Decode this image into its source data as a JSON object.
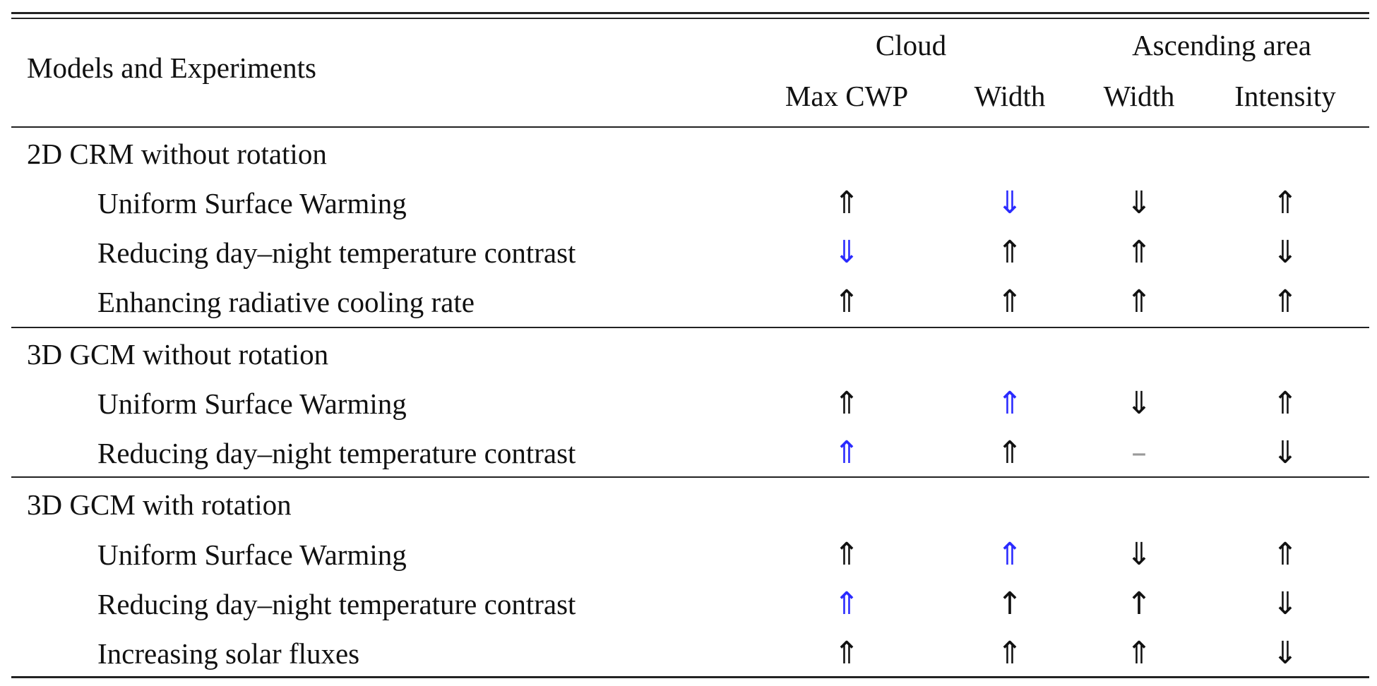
{
  "table": {
    "header": {
      "row_label": "Models and Experiments",
      "groups": [
        {
          "label": "Cloud",
          "columns": [
            "Max CWP",
            "Width"
          ]
        },
        {
          "label": "Ascending area",
          "columns": [
            "Width",
            "Intensity"
          ]
        }
      ]
    },
    "legend_symbols": {
      "up_double": "⇑",
      "down_double": "⇓",
      "up_single": "↑",
      "none": "–"
    },
    "colors": {
      "highlight": "#2a2aff",
      "normal": "#111111",
      "dash": "#9a9a9a"
    },
    "sections": [
      {
        "title": "2D CRM without rotation",
        "rows": [
          {
            "label": "Uniform Surface Warming",
            "cells": [
              {
                "v": "⇑",
                "hl": false
              },
              {
                "v": "⇓",
                "hl": true
              },
              {
                "v": "⇓",
                "hl": false
              },
              {
                "v": "⇑",
                "hl": false
              }
            ]
          },
          {
            "label": "Reducing day–night temperature contrast",
            "cells": [
              {
                "v": "⇓",
                "hl": true
              },
              {
                "v": "⇑",
                "hl": false
              },
              {
                "v": "⇑",
                "hl": false
              },
              {
                "v": "⇓",
                "hl": false
              }
            ]
          },
          {
            "label": "Enhancing radiative cooling rate",
            "cells": [
              {
                "v": "⇑",
                "hl": false
              },
              {
                "v": "⇑",
                "hl": false
              },
              {
                "v": "⇑",
                "hl": false
              },
              {
                "v": "⇑",
                "hl": false
              }
            ]
          }
        ]
      },
      {
        "title": "3D GCM without rotation",
        "rows": [
          {
            "label": "Uniform Surface Warming",
            "cells": [
              {
                "v": "⇑",
                "hl": false
              },
              {
                "v": "⇑",
                "hl": true
              },
              {
                "v": "⇓",
                "hl": false
              },
              {
                "v": "⇑",
                "hl": false
              }
            ]
          },
          {
            "label": "Reducing day–night temperature contrast",
            "cells": [
              {
                "v": "⇑",
                "hl": true
              },
              {
                "v": "⇑",
                "hl": false
              },
              {
                "v": "–",
                "hl": false
              },
              {
                "v": "⇓",
                "hl": false
              }
            ]
          }
        ]
      },
      {
        "title": "3D GCM with rotation",
        "rows": [
          {
            "label": "Uniform Surface Warming",
            "cells": [
              {
                "v": "⇑",
                "hl": false
              },
              {
                "v": "⇑",
                "hl": true
              },
              {
                "v": "⇓",
                "hl": false
              },
              {
                "v": "⇑",
                "hl": false
              }
            ]
          },
          {
            "label": "Reducing day–night temperature contrast",
            "cells": [
              {
                "v": "⇑",
                "hl": true
              },
              {
                "v": "↑",
                "hl": false
              },
              {
                "v": "↑",
                "hl": false
              },
              {
                "v": "⇓",
                "hl": false
              }
            ]
          },
          {
            "label": "Increasing solar fluxes",
            "cells": [
              {
                "v": "⇑",
                "hl": false
              },
              {
                "v": "⇑",
                "hl": false
              },
              {
                "v": "⇑",
                "hl": false
              },
              {
                "v": "⇓",
                "hl": false
              }
            ]
          }
        ]
      }
    ]
  }
}
